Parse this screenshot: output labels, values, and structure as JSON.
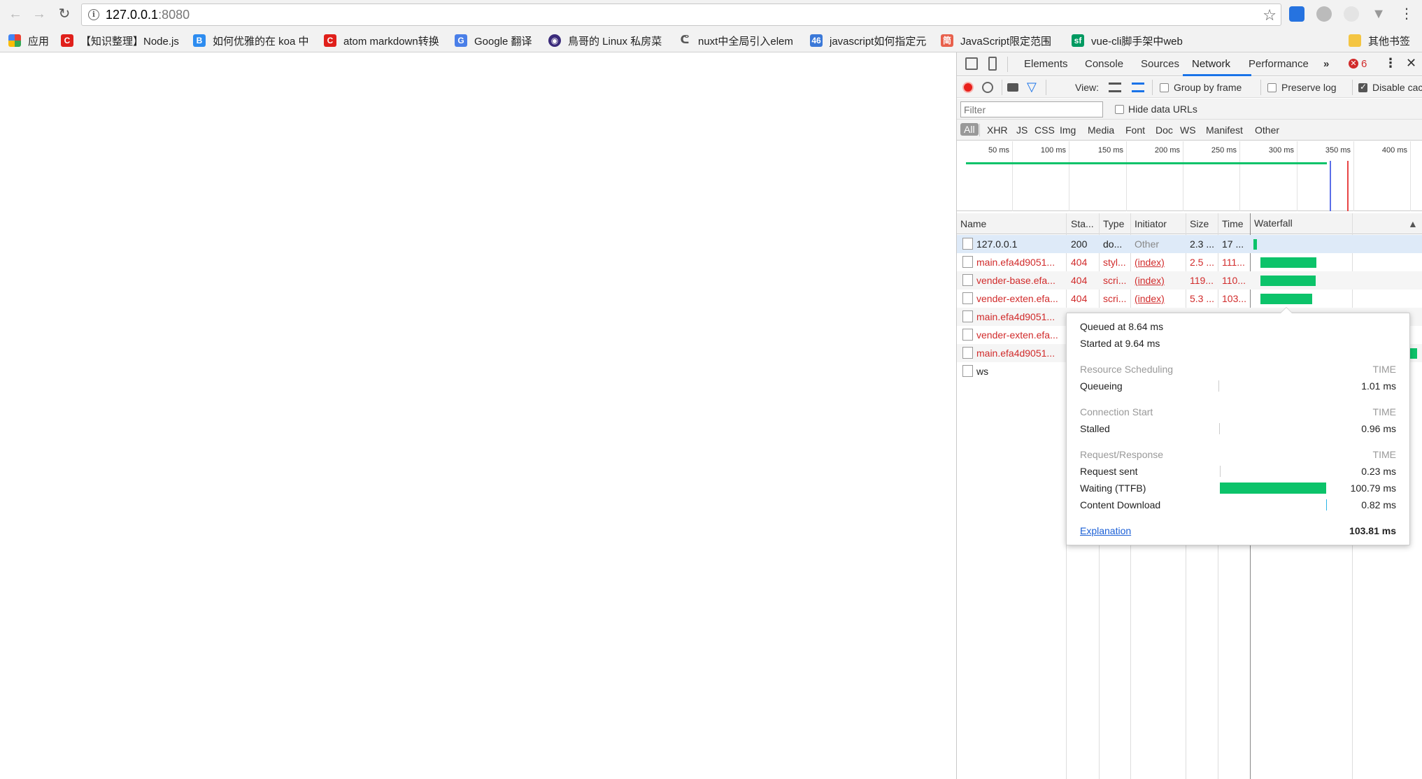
{
  "browser": {
    "url_host": "127.0.0.1",
    "url_port": ":8080",
    "bookmarks": [
      {
        "label": "应用",
        "icon": "apps-grid-icon",
        "color": "#e94235"
      },
      {
        "label": "【知识整理】Node.js",
        "icon": "csdn-c-icon",
        "color": "#e0201b"
      },
      {
        "label": "如何优雅的在 koa 中",
        "icon": "blog-b-icon",
        "color": "#2d8cf0"
      },
      {
        "label": "atom markdown转换",
        "icon": "csdn-c-icon",
        "color": "#e0201b"
      },
      {
        "label": "Google 翻译",
        "icon": "google-translate-icon",
        "color": "#4a7fe8"
      },
      {
        "label": "鳥哥的 Linux 私房菜",
        "icon": "vbird-icon",
        "color": "#3a2a7a"
      },
      {
        "label": "nuxt中全局引入elem",
        "icon": "segmentfault-icon",
        "color": "#666666"
      },
      {
        "label": "javascript如何指定元",
        "icon": "site-icon",
        "color": "#3a78d8"
      },
      {
        "label": "JavaScript限定范围",
        "icon": "jianshu-icon",
        "color": "#e8604c"
      },
      {
        "label": "vue-cli脚手架中web",
        "icon": "segmentfault-sf-icon",
        "color": "#009a61"
      }
    ],
    "other_bookmarks": "其他书签"
  },
  "devtools": {
    "tabs": [
      "Elements",
      "Console",
      "Sources",
      "Network",
      "Performance"
    ],
    "active_tab": "Network",
    "error_count": "6",
    "toolbar": {
      "view_label": "View:",
      "group_by_frame": "Group by frame",
      "preserve_log": "Preserve log",
      "disable_cache": "Disable cache"
    },
    "filter_placeholder": "Filter",
    "hide_data_urls": "Hide data URLs",
    "types": [
      "All",
      "XHR",
      "JS",
      "CSS",
      "Img",
      "Media",
      "Font",
      "Doc",
      "WS",
      "Manifest",
      "Other"
    ],
    "overview_ticks": [
      "50 ms",
      "100 ms",
      "150 ms",
      "200 ms",
      "250 ms",
      "300 ms",
      "350 ms",
      "400 ms"
    ],
    "columns": [
      "Name",
      "Sta...",
      "Type",
      "Initiator",
      "Size",
      "Time",
      "Waterfall"
    ],
    "rows": [
      {
        "name": "127.0.0.1",
        "status": "200",
        "type": "do...",
        "initiator": "Other",
        "size": "2.3 ...",
        "time": "17 ...",
        "error": false
      },
      {
        "name": "main.efa4d9051...",
        "status": "404",
        "type": "styl...",
        "initiator": "(index)",
        "size": "2.5 ...",
        "time": "111...",
        "error": true
      },
      {
        "name": "vender-base.efa...",
        "status": "404",
        "type": "scri...",
        "initiator": "(index)",
        "size": "119...",
        "time": "110...",
        "error": true
      },
      {
        "name": "vender-exten.efa...",
        "status": "404",
        "type": "scri...",
        "initiator": "(index)",
        "size": "5.3 ...",
        "time": "103...",
        "error": true
      },
      {
        "name": "main.efa4d9051...",
        "status": "",
        "type": "",
        "initiator": "",
        "size": "",
        "time": "",
        "error": true
      },
      {
        "name": "vender-exten.efa...",
        "status": "",
        "type": "",
        "initiator": "",
        "size": "",
        "time": "",
        "error": true
      },
      {
        "name": "main.efa4d9051...",
        "status": "",
        "type": "",
        "initiator": "",
        "size": "",
        "time": "",
        "error": true
      },
      {
        "name": "ws",
        "status": "",
        "type": "",
        "initiator": "",
        "size": "",
        "time": "",
        "error": false
      }
    ]
  },
  "timing": {
    "queued_at": "Queued at 8.64 ms",
    "started_at": "Started at 9.64 ms",
    "sections": [
      {
        "header": "Resource Scheduling",
        "time_label": "TIME",
        "items": [
          {
            "label": "Queueing",
            "value": "1.01 ms",
            "ms": 1.01
          }
        ]
      },
      {
        "header": "Connection Start",
        "time_label": "TIME",
        "items": [
          {
            "label": "Stalled",
            "value": "0.96 ms",
            "ms": 0.96
          }
        ]
      },
      {
        "header": "Request/Response",
        "time_label": "TIME",
        "items": [
          {
            "label": "Request sent",
            "value": "0.23 ms",
            "ms": 0.23
          },
          {
            "label": "Waiting (TTFB)",
            "value": "100.79 ms",
            "ms": 100.79
          },
          {
            "label": "Content Download",
            "value": "0.82 ms",
            "ms": 0.82
          }
        ]
      }
    ],
    "explanation": "Explanation",
    "total": "103.81 ms",
    "bar_color": "#0cc36a"
  }
}
